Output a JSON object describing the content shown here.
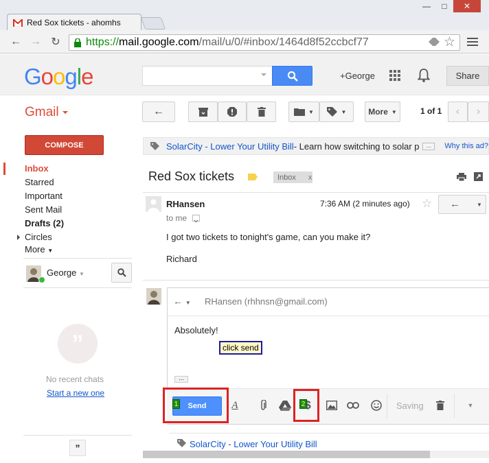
{
  "browser": {
    "tab_title": "Red Sox tickets - ahomhs",
    "url_scheme": "https://",
    "url_host": "mail.google.com",
    "url_path": "/mail/u/0/#inbox/1464d8f52ccbcf77"
  },
  "header": {
    "logo": [
      "G",
      "o",
      "o",
      "g",
      "l",
      "e"
    ],
    "logo_colors": [
      "#4285f4",
      "#ea4335",
      "#fbbc05",
      "#4285f4",
      "#34a853",
      "#ea4335"
    ],
    "plus_user": "+George",
    "share_label": "Share"
  },
  "actionbar": {
    "app_label": "Gmail",
    "more_label": "More",
    "pager": "1 of 1"
  },
  "sidebar": {
    "compose_label": "COMPOSE",
    "items": [
      {
        "label": "Inbox",
        "style": "active"
      },
      {
        "label": "Starred",
        "style": "normal"
      },
      {
        "label": "Important",
        "style": "normal"
      },
      {
        "label": "Sent Mail",
        "style": "normal"
      },
      {
        "label": "Drafts (2)",
        "style": "bold"
      },
      {
        "label": "Circles",
        "style": "normal"
      },
      {
        "label": "More",
        "style": "normal"
      }
    ],
    "chat_user": "George",
    "no_chats": "No recent chats",
    "start_new": "Start a new one"
  },
  "ad": {
    "link": "SolarCity - Lower Your Utility Bill",
    "desc": " - Learn how switching to solar power can lower your bill",
    "why": "Why this ad?"
  },
  "thread": {
    "subject": "Red Sox tickets",
    "inbox_tag": "Inbox",
    "inbox_tag_close": "x",
    "sender": "RHansen",
    "to": "to me",
    "time": "7:36 AM (2 minutes ago)",
    "body_line1": "I got two tickets to tonight's game, can you make it?",
    "body_line2": "Richard"
  },
  "reply": {
    "recipient": "RHansen (rhhnsn@gmail.com)",
    "text": "Absolutely!",
    "tooltip": "click send",
    "send_label": "Send",
    "step1": "1",
    "step2": "2",
    "saving": "Saving"
  },
  "bottom_ad": {
    "link": "SolarCity - Lower Your Utility Bill"
  }
}
